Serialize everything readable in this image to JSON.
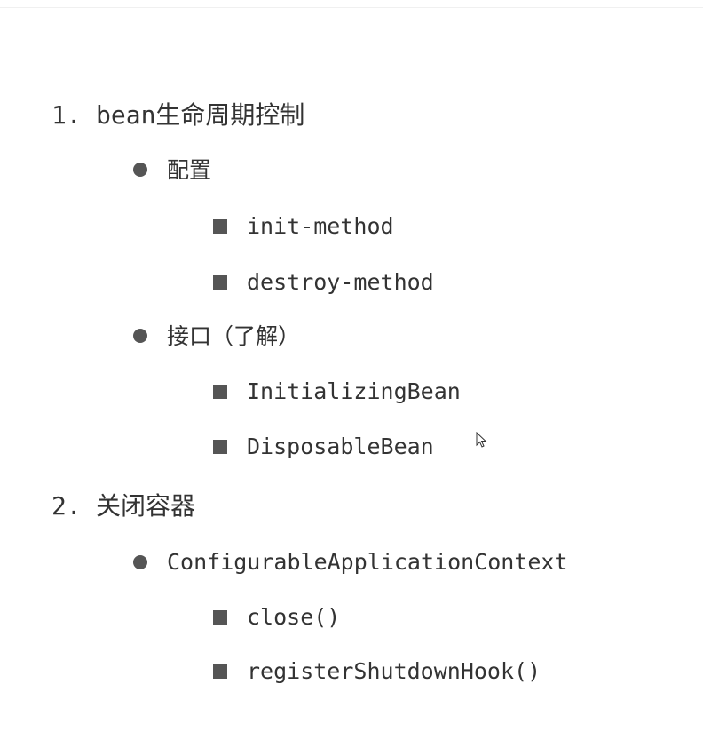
{
  "outline": {
    "section1": {
      "number": "1.",
      "title": "bean生命周期控制",
      "group1": {
        "label": "配置",
        "items": [
          "init-method",
          "destroy-method"
        ]
      },
      "group2": {
        "label": "接口（了解）",
        "items": [
          "InitializingBean",
          "DisposableBean"
        ]
      }
    },
    "section2": {
      "number": "2.",
      "title": "关闭容器",
      "group1": {
        "label": "ConfigurableApplicationContext",
        "items": [
          "close()",
          "registerShutdownHook()"
        ]
      }
    }
  },
  "colors": {
    "text": "#333333",
    "bullet": "#555555",
    "background": "#ffffff"
  },
  "icons": {
    "level2_bullet": "filled-circle",
    "level3_bullet": "filled-square",
    "cursor": "mouse-pointer-icon"
  }
}
